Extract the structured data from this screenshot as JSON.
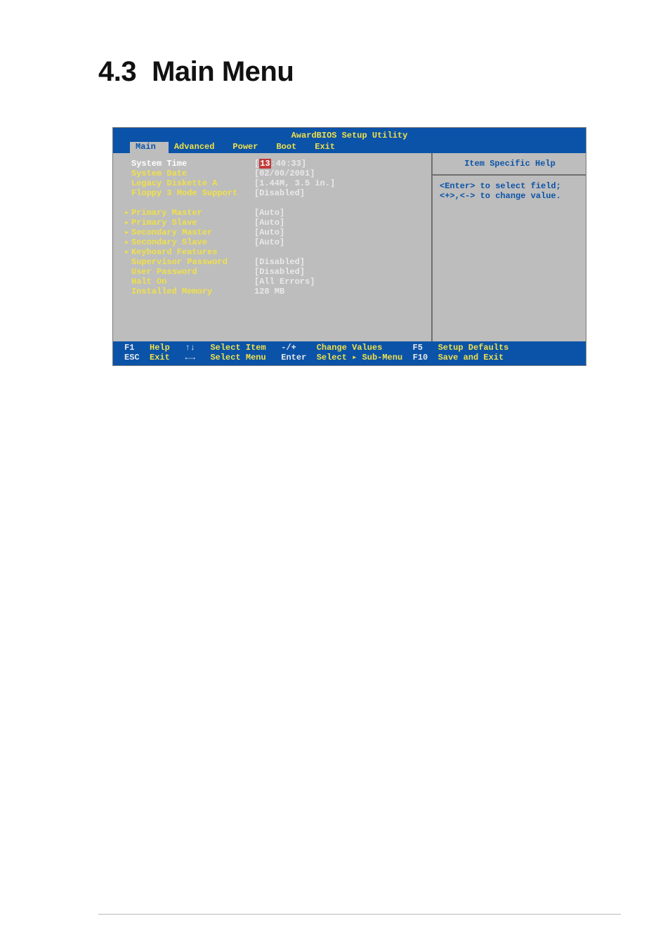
{
  "heading": {
    "number": "4.3",
    "title": "Main Menu"
  },
  "bios": {
    "title": "AwardBIOS Setup Utility",
    "tabs": [
      "Main",
      "Advanced",
      "Power",
      "Boot",
      "Exit"
    ],
    "activeTab": "Main",
    "items": [
      {
        "label": "System Time",
        "value_pre": "[",
        "value_sel": "13",
        "value_post": ":40:33]",
        "highlight": true,
        "submenu": false
      },
      {
        "label": "System Date",
        "value": "[02/00/2001]",
        "submenu": false
      },
      {
        "label": "Legacy Diskette A",
        "value": "[1.44M, 3.5 in.]",
        "submenu": false
      },
      {
        "label": "Floppy 3 Mode Support",
        "value": "[Disabled]",
        "submenu": false
      },
      {
        "gap": true
      },
      {
        "label": "Primary Master",
        "value": "[Auto]",
        "submenu": true
      },
      {
        "label": "Primary Slave",
        "value": "[Auto]",
        "submenu": true
      },
      {
        "label": "Secondary Master",
        "value": "[Auto]",
        "submenu": true
      },
      {
        "label": "Secondary Slave",
        "value": "[Auto]",
        "submenu": true
      },
      {
        "label": "Keyboard Features",
        "value": "",
        "submenu": true
      },
      {
        "label": "Supervisor Password",
        "value": "[Disabled]",
        "submenu": false
      },
      {
        "label": "User Password",
        "value": "[Disabled]",
        "submenu": false
      },
      {
        "label": "Halt On",
        "value": "[All Errors]",
        "submenu": false
      },
      {
        "label": "Installed Memory",
        "value": "128 MB",
        "submenu": false
      }
    ],
    "help": {
      "title": "Item Specific Help",
      "line1": "<Enter> to select field;",
      "line2": "<+>,<-> to change value."
    },
    "footer": {
      "f1": "F1",
      "help": "Help",
      "updown": "↑↓",
      "selectItem": "Select Item",
      "pm": "-/+",
      "changeValues": "Change Values",
      "f5": "F5",
      "setupDefaults": "Setup Defaults",
      "esc": "ESC",
      "exit": "Exit",
      "lr": "←→",
      "selectMenu": "Select Menu",
      "enter": "Enter",
      "selectSub": "Select ▸ Sub-Menu",
      "f10": "F10",
      "saveExit": "Save and Exit"
    }
  }
}
